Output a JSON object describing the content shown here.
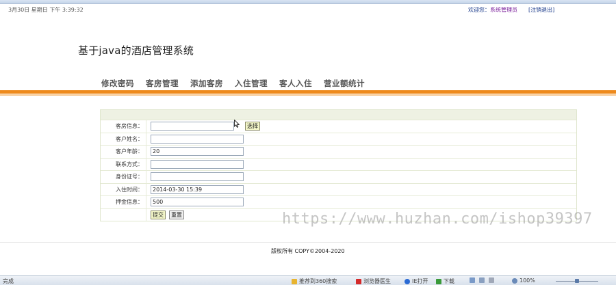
{
  "header": {
    "datetime": "3月30日 星期日 下午 3:39:32",
    "welcome_prefix": "欢迎您：",
    "welcome_user": "系统管理员",
    "logout": "[注销退出]",
    "system_title": "基于java的酒店管理系统"
  },
  "nav": {
    "items": [
      "修改密码",
      "客房管理",
      "添加客房",
      "入住管理",
      "客人入住",
      "营业额统计"
    ]
  },
  "form": {
    "fields": [
      {
        "label": "客房信息：",
        "value": ""
      },
      {
        "label": "客户姓名：",
        "value": ""
      },
      {
        "label": "客户年龄：",
        "value": "20"
      },
      {
        "label": "联系方式：",
        "value": ""
      },
      {
        "label": "身份证号：",
        "value": ""
      },
      {
        "label": "入住时间：",
        "value": "2014-03-30 15:39"
      },
      {
        "label": "押金信息：",
        "value": "500"
      }
    ],
    "choose_label": "选择",
    "submit_label": "提交",
    "reset_label": "重置"
  },
  "watermark": "https://www.huzhan.com/ishop39397",
  "footer": {
    "copyright": "版权所有  COPY©2004-2020"
  },
  "statusbar": {
    "left": "完成",
    "recommend": "推荐到360搜索",
    "browser_doctor": "浏览器医生",
    "ie_open": "IE打开",
    "download": "下载",
    "zoom": "100%"
  },
  "colors": {
    "accent": "#ee8a1c",
    "panel_head": "#eef1e3",
    "button_bg": "#f3f6c8"
  }
}
